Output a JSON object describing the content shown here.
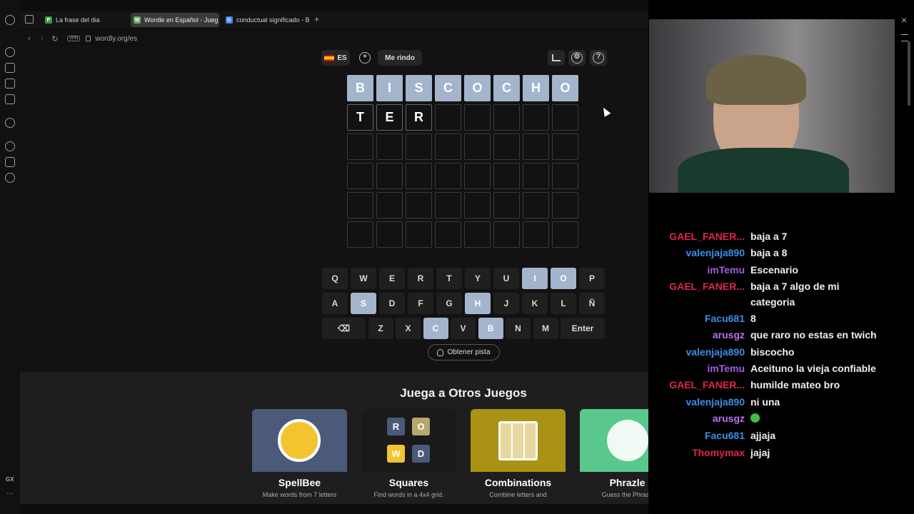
{
  "browser": {
    "tabs": [
      {
        "title": "La frase del dia",
        "favicon": "P",
        "color": "#3d9a46"
      },
      {
        "title": "Wordle en Español - Jueg",
        "favicon": "W",
        "color": "#6aa864"
      },
      {
        "title": "conductual significado - B",
        "favicon": "G",
        "color": "#4285f4"
      }
    ],
    "new_tab": "+",
    "url": "wordly.org/es",
    "vpn": "VPN",
    "gx": "GX"
  },
  "header": {
    "lang": "ES",
    "give_up": "Me rindo"
  },
  "board": {
    "rows": [
      [
        {
          "l": "B",
          "s": "absent"
        },
        {
          "l": "I",
          "s": "absent"
        },
        {
          "l": "S",
          "s": "absent"
        },
        {
          "l": "C",
          "s": "absent"
        },
        {
          "l": "O",
          "s": "absent"
        },
        {
          "l": "C",
          "s": "absent"
        },
        {
          "l": "H",
          "s": "absent"
        },
        {
          "l": "O",
          "s": "absent"
        }
      ],
      [
        {
          "l": "T",
          "s": "filled"
        },
        {
          "l": "E",
          "s": "filled"
        },
        {
          "l": "R",
          "s": "filled"
        },
        {
          "l": "",
          "s": "empty"
        },
        {
          "l": "",
          "s": "empty"
        },
        {
          "l": "",
          "s": "empty"
        },
        {
          "l": "",
          "s": "empty"
        },
        {
          "l": "",
          "s": "empty"
        }
      ],
      [
        {
          "l": "",
          "s": "empty"
        },
        {
          "l": "",
          "s": "empty"
        },
        {
          "l": "",
          "s": "empty"
        },
        {
          "l": "",
          "s": "empty"
        },
        {
          "l": "",
          "s": "empty"
        },
        {
          "l": "",
          "s": "empty"
        },
        {
          "l": "",
          "s": "empty"
        },
        {
          "l": "",
          "s": "empty"
        }
      ],
      [
        {
          "l": "",
          "s": "empty"
        },
        {
          "l": "",
          "s": "empty"
        },
        {
          "l": "",
          "s": "empty"
        },
        {
          "l": "",
          "s": "empty"
        },
        {
          "l": "",
          "s": "empty"
        },
        {
          "l": "",
          "s": "empty"
        },
        {
          "l": "",
          "s": "empty"
        },
        {
          "l": "",
          "s": "empty"
        }
      ],
      [
        {
          "l": "",
          "s": "empty"
        },
        {
          "l": "",
          "s": "empty"
        },
        {
          "l": "",
          "s": "empty"
        },
        {
          "l": "",
          "s": "empty"
        },
        {
          "l": "",
          "s": "empty"
        },
        {
          "l": "",
          "s": "empty"
        },
        {
          "l": "",
          "s": "empty"
        },
        {
          "l": "",
          "s": "empty"
        }
      ],
      [
        {
          "l": "",
          "s": "empty"
        },
        {
          "l": "",
          "s": "empty"
        },
        {
          "l": "",
          "s": "empty"
        },
        {
          "l": "",
          "s": "empty"
        },
        {
          "l": "",
          "s": "empty"
        },
        {
          "l": "",
          "s": "empty"
        },
        {
          "l": "",
          "s": "empty"
        },
        {
          "l": "",
          "s": "empty"
        }
      ]
    ]
  },
  "keyboard": {
    "rows": [
      [
        "Q",
        "W",
        "E",
        "R",
        "T",
        "Y",
        "U",
        "I",
        "O",
        "P"
      ],
      [
        "A",
        "S",
        "D",
        "F",
        "G",
        "H",
        "J",
        "K",
        "L",
        "Ñ"
      ],
      [
        "⌫",
        "Z",
        "X",
        "C",
        "V",
        "B",
        "N",
        "M",
        "Enter"
      ]
    ],
    "used": [
      "I",
      "O",
      "S",
      "H",
      "C",
      "B"
    ]
  },
  "hint": "Obtener pista",
  "games": {
    "title": "Juega a Otros Juegos",
    "items": [
      {
        "name": "SpellBee",
        "desc": "Make words from 7 letters",
        "bg": "#4a5a78"
      },
      {
        "name": "Squares",
        "desc": "Find words in a 4x4 grid.",
        "bg": "#1a1a1a"
      },
      {
        "name": "Combinations",
        "desc": "Combine letters and",
        "bg": "#a99214"
      },
      {
        "name": "Phrazle",
        "desc": "Guess the Phrase",
        "bg": "#5ac88c"
      }
    ],
    "squares_tiles": [
      "R",
      "O",
      "W",
      "D"
    ]
  },
  "chat": [
    {
      "user": "GAEL_FANER...",
      "color": "#e0254a",
      "text": "baja a 7"
    },
    {
      "user": "valenjaja890",
      "color": "#3a8ee6",
      "text": "baja a 8"
    },
    {
      "user": "imTemu",
      "color": "#a35ce8",
      "text": "Escenario"
    },
    {
      "user": "GAEL_FANER...",
      "color": "#e0254a",
      "text": "baja a 7 algo de mi categoria"
    },
    {
      "user": "Facu681",
      "color": "#3a8ee6",
      "text": "8"
    },
    {
      "user": "arusgz",
      "color": "#b773e8",
      "text": "que raro no estas en twich"
    },
    {
      "user": "valenjaja890",
      "color": "#3a8ee6",
      "text": "biscocho"
    },
    {
      "user": "imTemu",
      "color": "#a35ce8",
      "text": "Aceituno la vieja confiable"
    },
    {
      "user": "GAEL_FANER...",
      "color": "#e0254a",
      "text": "humilde mateo bro"
    },
    {
      "user": "valenjaja890",
      "color": "#3a8ee6",
      "text": "ni una"
    },
    {
      "user": "arusgz",
      "color": "#b773e8",
      "text": ""
    },
    {
      "user": "Facu681",
      "color": "#3a8ee6",
      "text": "ajjaja"
    },
    {
      "user": "Thomymax",
      "color": "#e0254a",
      "text": "jajaj"
    }
  ]
}
